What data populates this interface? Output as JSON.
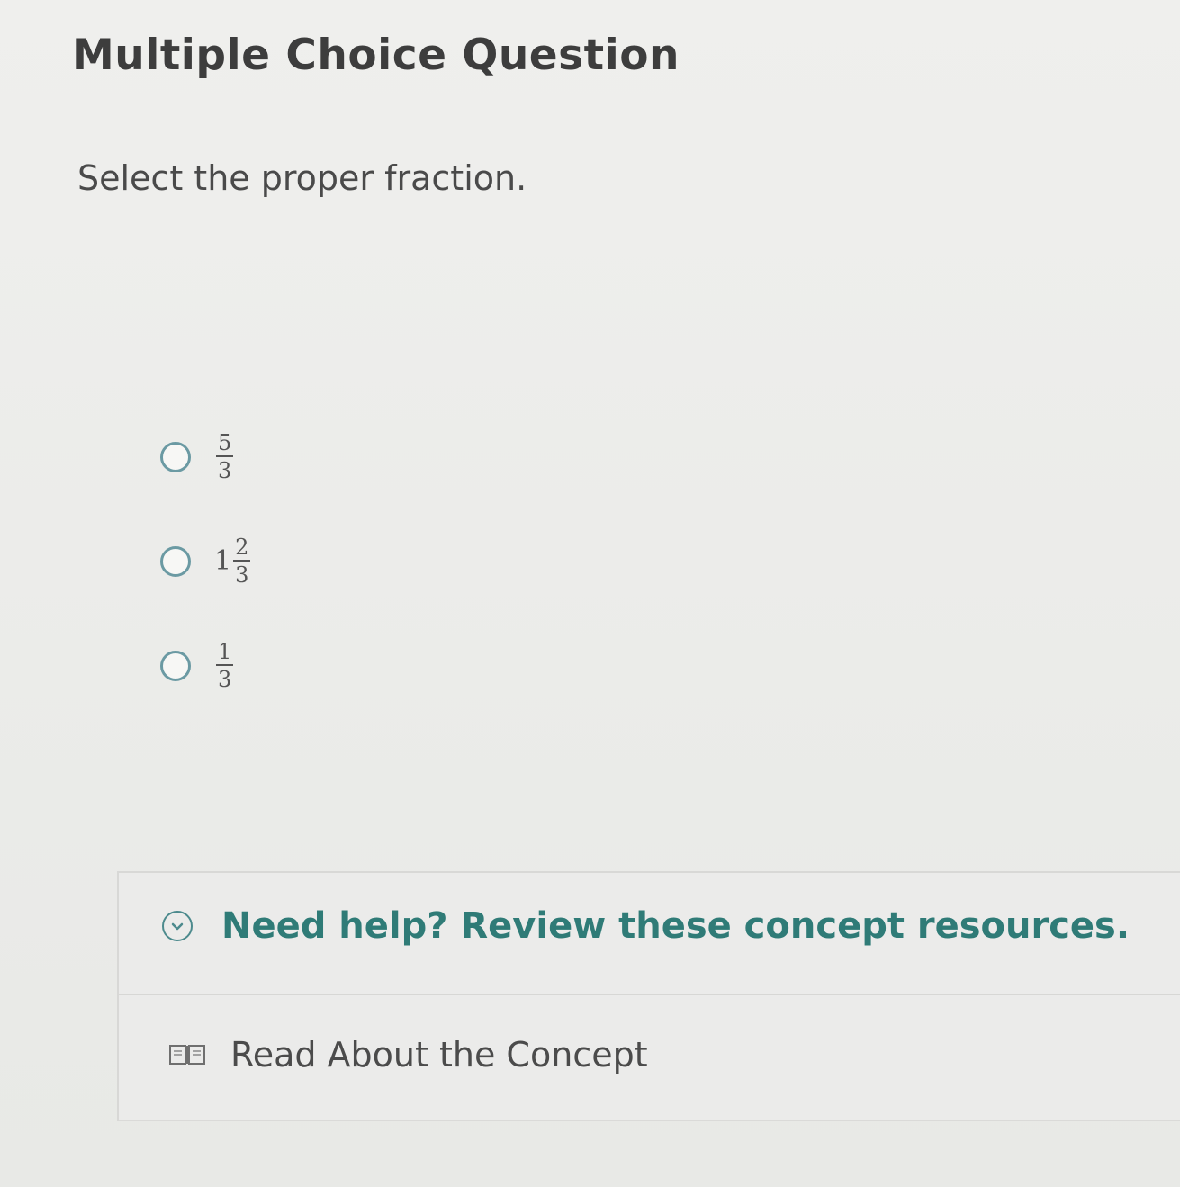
{
  "question": {
    "title": "Multiple Choice Question",
    "prompt": "Select the proper fraction."
  },
  "options": [
    {
      "whole": "",
      "numerator": "5",
      "denominator": "3"
    },
    {
      "whole": "1",
      "numerator": "2",
      "denominator": "3"
    },
    {
      "whole": "",
      "numerator": "1",
      "denominator": "3"
    }
  ],
  "help": {
    "header_text": "Need help? Review these concept resources.",
    "icon": "chevron-down-circle-icon",
    "resources": [
      {
        "label": "Read About the Concept",
        "icon": "book-icon"
      }
    ]
  },
  "colors": {
    "accent": "#2f7b77",
    "radio_border": "#6b9aa3",
    "text": "#3e3e3e"
  }
}
